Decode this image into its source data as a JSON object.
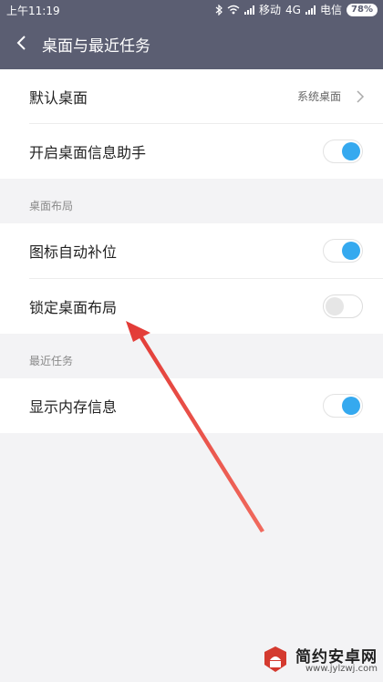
{
  "status": {
    "time": "上午11:19",
    "carrier1": "移动",
    "network": "4G",
    "carrier2": "电信",
    "battery": "78%"
  },
  "header": {
    "title": "桌面与最近任务"
  },
  "rows": {
    "default_desktop": {
      "label": "默认桌面",
      "value": "系统桌面"
    },
    "info_assistant": {
      "label": "开启桌面信息助手",
      "on": true
    },
    "auto_fill": {
      "label": "图标自动补位",
      "on": true
    },
    "lock_layout": {
      "label": "锁定桌面布局",
      "on": false
    },
    "memory_info": {
      "label": "显示内存信息",
      "on": true
    }
  },
  "sections": {
    "layout": "桌面布局",
    "recent": "最近任务"
  },
  "watermark": {
    "brand": "简约安卓网",
    "url": "www.jylzwj.com"
  },
  "colors": {
    "header": "#5b5e72",
    "toggle_on": "#35a9ef",
    "arrow": "#e23a36"
  }
}
